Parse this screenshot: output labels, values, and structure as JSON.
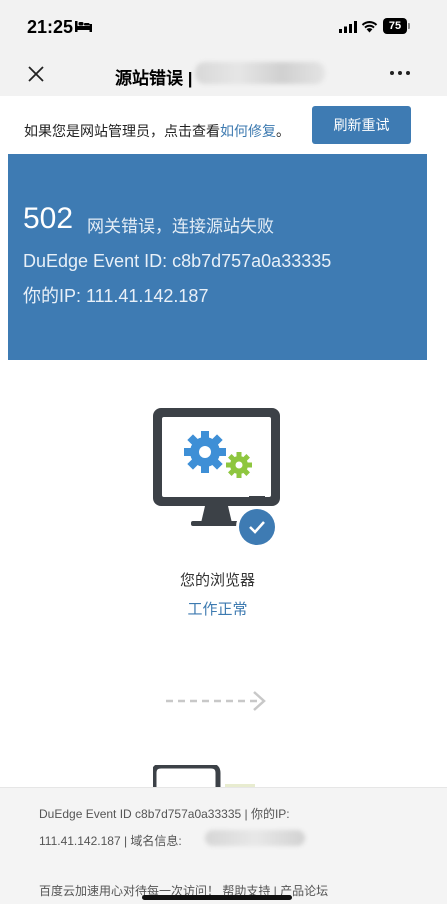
{
  "status_bar": {
    "time": "21:25",
    "battery": "75"
  },
  "nav": {
    "title": "源站错误 |",
    "blurred_domain": "...tion"
  },
  "admin_notice": {
    "text_before": "如果您是网站管理员，点击查看",
    "link": "如何修复",
    "text_after": "。",
    "refresh_button": "刷新重试"
  },
  "error": {
    "code": "502",
    "message": "网关错误，连接源站失败",
    "event_id_line": "DuEdge Event ID: c8b7d757a0a33335",
    "ip_line": "你的IP: 111.41.142.187"
  },
  "browser_status": {
    "label": "您的浏览器",
    "status": "工作正常"
  },
  "footer": {
    "line1": "DuEdge Event ID c8b7d757a0a33335 | 你的IP:",
    "line2": "111.41.142.187 | 域名信息:",
    "line3": "百度云加速用心对待每一次访问！ 帮助支持 | 产品论坛"
  },
  "colors": {
    "accent": "#3e7bb3",
    "banner": "#3e7bb3",
    "gear_blue": "#3e8fd6",
    "gear_green": "#8ec63f",
    "monitor": "#3c4147"
  },
  "icons": [
    "bed-icon",
    "signal-icon",
    "wifi-icon",
    "close-icon",
    "more-icon",
    "monitor-gears-icon",
    "checkmark-icon",
    "arrow-right-icon"
  ]
}
